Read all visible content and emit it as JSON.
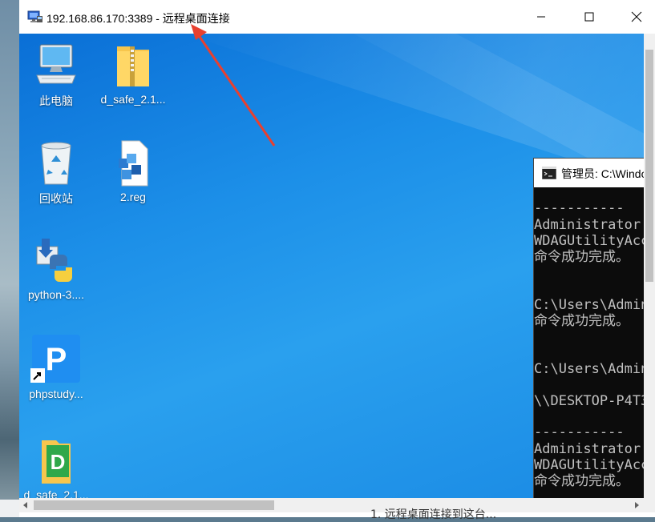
{
  "window": {
    "title": "192.168.86.170:3389 - 远程桌面连接",
    "minimize_icon": "minimize-icon",
    "maximize_icon": "maximize-icon",
    "close_icon": "close-icon"
  },
  "desktop_icons": [
    {
      "label": "此电脑",
      "icon": "computer-icon"
    },
    {
      "label": "d_safe_2.1...",
      "icon": "zip-folder-icon"
    },
    {
      "label": "回收站",
      "icon": "recycle-bin-icon"
    },
    {
      "label": "2.reg",
      "icon": "registry-file-icon"
    },
    {
      "label": "python-3....",
      "icon": "python-installer-icon"
    },
    {
      "label": "phpstudy...",
      "icon": "phpstudy-icon"
    },
    {
      "label": "d_safe_2.1...",
      "icon": "d-safe-icon"
    }
  ],
  "cmd": {
    "title": "管理员: C:\\Windo",
    "lines": [
      "-----------",
      "Administrator",
      "WDAGUtilityAcc",
      "命令成功完成。",
      "",
      "C:\\Users\\Admin",
      "命令成功完成。",
      "",
      "C:\\Users\\Admin",
      "",
      "\\\\DESKTOP-P4T3",
      "",
      "-----------",
      "Administrator",
      "WDAGUtilityAcc",
      "命令成功完成。"
    ]
  },
  "host": {
    "partial_text": "1. 远程桌面连接到这台..."
  },
  "colors": {
    "desktop_blue": "#1c8fe8",
    "arrow_red": "#e8402f"
  }
}
